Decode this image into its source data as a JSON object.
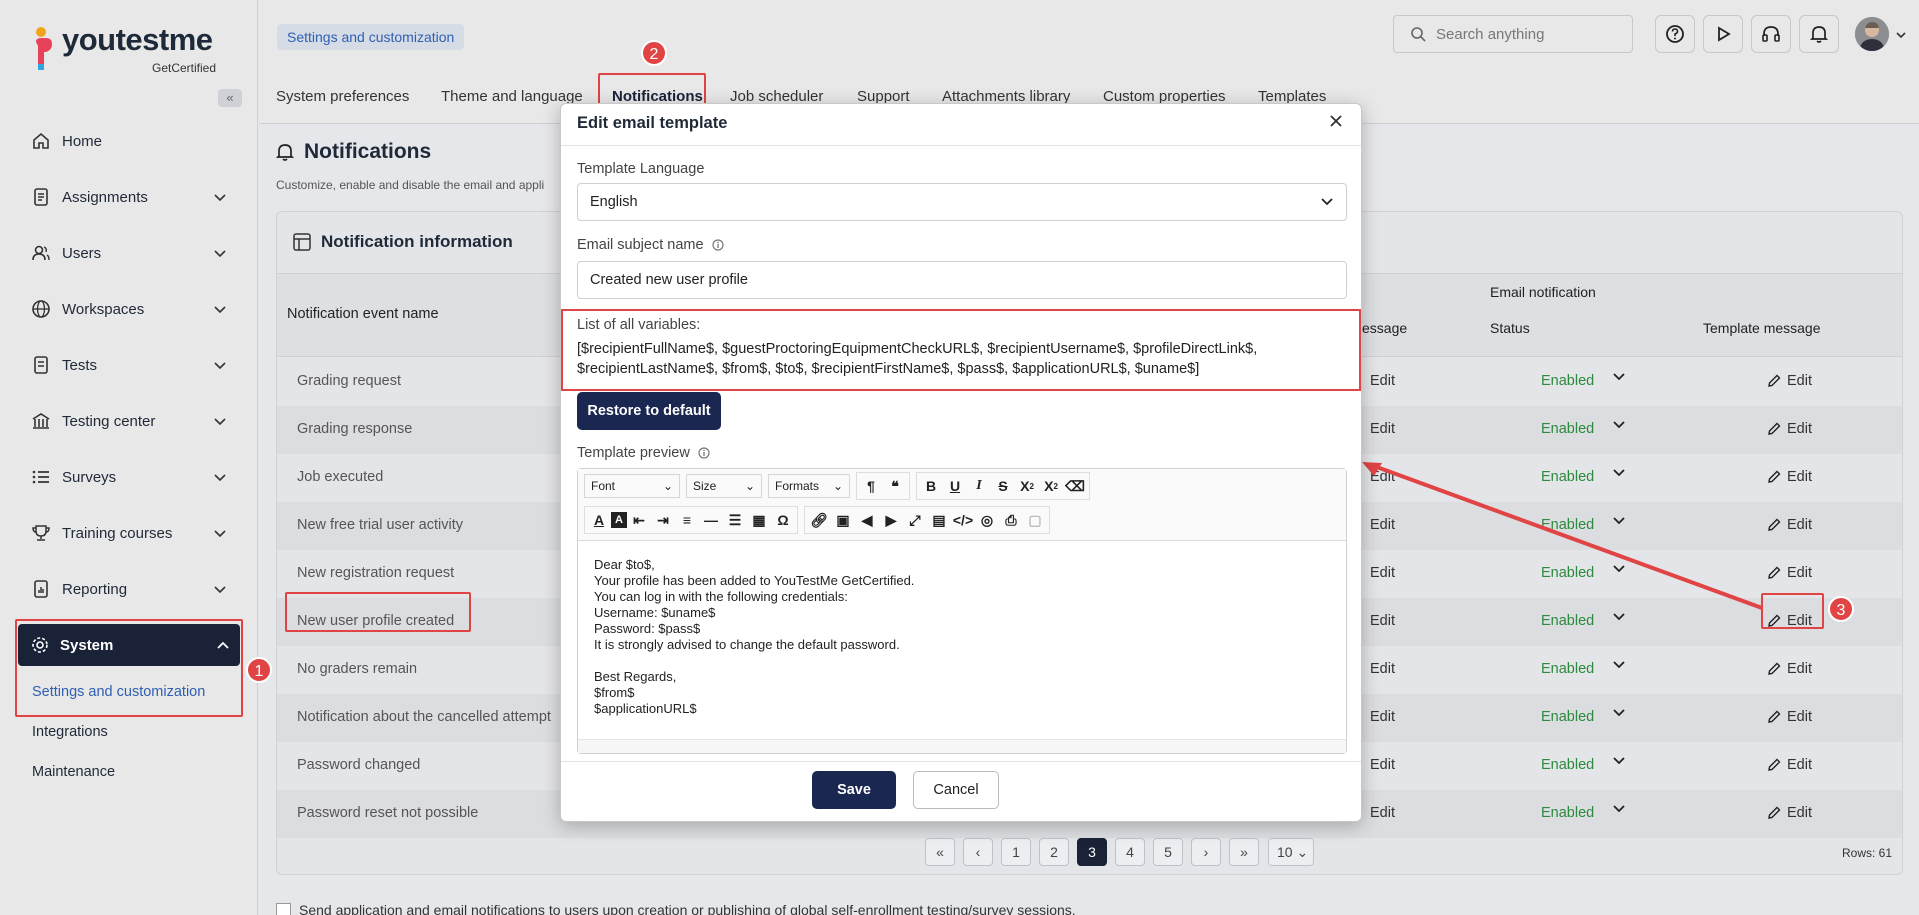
{
  "app": {
    "logo_text": "youtestme",
    "logo_sub": "GetCertified"
  },
  "sidebar": {
    "items": [
      {
        "label": "Home",
        "icon": "home-icon"
      },
      {
        "label": "Assignments",
        "icon": "assignment-icon"
      },
      {
        "label": "Users",
        "icon": "users-icon"
      },
      {
        "label": "Workspaces",
        "icon": "globe-icon"
      },
      {
        "label": "Tests",
        "icon": "tests-icon"
      },
      {
        "label": "Testing center",
        "icon": "building-icon"
      },
      {
        "label": "Surveys",
        "icon": "list-icon"
      },
      {
        "label": "Training courses",
        "icon": "trophy-icon"
      },
      {
        "label": "Reporting",
        "icon": "report-icon"
      }
    ],
    "active": "System",
    "sub_items": [
      "Settings and customization",
      "Integrations",
      "Maintenance"
    ]
  },
  "header": {
    "breadcrumb": "Settings and customization",
    "search_placeholder": "Search anything"
  },
  "tabs": [
    "System preferences",
    "Theme and language",
    "Notifications",
    "Job scheduler",
    "Support",
    "Attachments library",
    "Custom properties",
    "Templates"
  ],
  "page": {
    "title": "Notifications",
    "subtitle": "Customize, enable and disable the email and appli",
    "panel_title": "Notification information",
    "col_event": "Notification event name",
    "col_group": "Email notification",
    "col_message": "essage",
    "col_status": "Status",
    "col_template": "Template message"
  },
  "table": {
    "rows": [
      {
        "name": "Grading request",
        "edit1": "Edit",
        "status": "Enabled",
        "edit2": "Edit"
      },
      {
        "name": "Grading response",
        "edit1": "Edit",
        "status": "Enabled",
        "edit2": "Edit"
      },
      {
        "name": "Job executed",
        "edit1": "Edit",
        "status": "Enabled",
        "edit2": "Edit"
      },
      {
        "name": "New free trial user activity",
        "edit1": "Edit",
        "status": "Enabled",
        "edit2": "Edit"
      },
      {
        "name": "New registration request",
        "edit1": "Edit",
        "status": "Enabled",
        "edit2": "Edit"
      },
      {
        "name": "New user profile created",
        "edit1": "Edit",
        "status": "Enabled",
        "edit2": "Edit"
      },
      {
        "name": "No graders remain",
        "edit1": "Edit",
        "status": "Enabled",
        "edit2": "Edit"
      },
      {
        "name": "Notification about the cancelled attempt",
        "edit1": "Edit",
        "status": "Enabled",
        "edit2": "Edit"
      },
      {
        "name": "Password changed",
        "edit1": "Edit",
        "status": "Enabled",
        "edit2": "Edit"
      },
      {
        "name": "Password reset not possible",
        "edit1": "Edit",
        "status": "Enabled",
        "edit2": "Edit"
      }
    ]
  },
  "pagination": {
    "pages": [
      "1",
      "2",
      "3",
      "4",
      "5"
    ],
    "current": "3",
    "page_size": "10",
    "rows_label": "Rows: 61"
  },
  "footer_text": "Send application and email notifications to users upon creation or publishing of global self-enrollment testing/survey sessions.",
  "modal": {
    "title": "Edit email template",
    "language_label": "Template Language",
    "language_value": "English",
    "subject_label": "Email subject name",
    "subject_value": "Created new user profile",
    "vars_label": "List of all variables:",
    "vars_text": "[$recipientFullName$, $guestProctoringEquipmentCheckURL$, $recipientUsername$, $profileDirectLink$, $recipientLastName$, $from$, $to$, $recipientFirstName$, $pass$, $applicationURL$, $uname$]",
    "restore_label": "Restore to default",
    "preview_label": "Template preview",
    "toolbar": {
      "font": "Font",
      "size": "Size",
      "formats": "Formats"
    },
    "body": "Dear $to$,\nYour profile has been added to YouTestMe GetCertified.\nYou can log in with the following credentials:\nUsername: $uname$\nPassword: $pass$\nIt is strongly advised to change the default password.\n\nBest Regards,\n$from$\n$applicationURL$",
    "save_label": "Save",
    "cancel_label": "Cancel"
  },
  "annotations": {
    "badge1": "1",
    "badge2": "2",
    "badge3": "3"
  },
  "colors": {
    "accent": "#1a2751",
    "highlight": "#e04444",
    "enabled": "#2b8a3e"
  }
}
